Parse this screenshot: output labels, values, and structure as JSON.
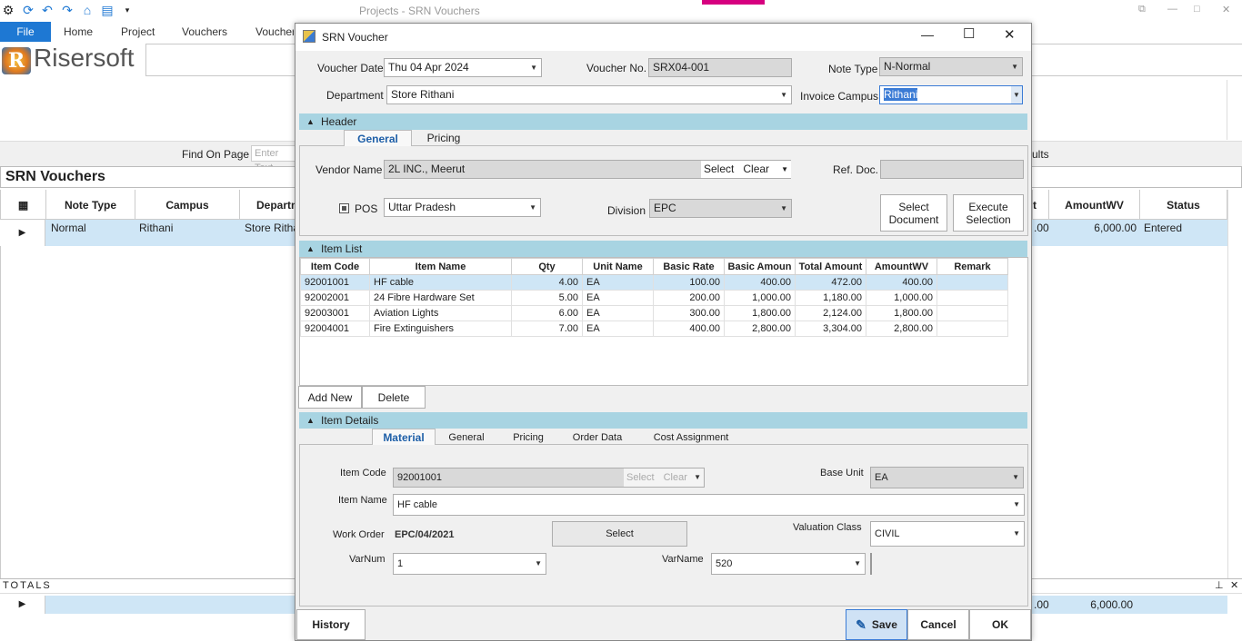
{
  "app": {
    "title": "Projects - SRN Vouchers",
    "brand": "Risersoft"
  },
  "ribbon": {
    "file": "File",
    "tabs": [
      "Home",
      "Project",
      "Vouchers",
      "Vouchers"
    ]
  },
  "find": {
    "label": "Find On Page",
    "placeholder": "Enter Text",
    "results": "ults"
  },
  "grid": {
    "title": "SRN Vouchers",
    "columns": [
      "Note Type",
      "Campus",
      "Department",
      "AmountWV",
      "Status"
    ],
    "row": {
      "note_type": "Normal",
      "campus": "Rithani",
      "department": "Store Ritha",
      "amount_partial": ".00",
      "amountwv": "6,000.00",
      "status": "Entered"
    },
    "header_partial": "t"
  },
  "totals": {
    "label": "TOTALS",
    "amount_partial": ".00",
    "amountwv": "6,000.00"
  },
  "dialog": {
    "title": "SRN Voucher",
    "voucher_date_label": "Voucher Date",
    "voucher_date": "Thu 04 Apr 2024",
    "voucher_no_label": "Voucher No.",
    "voucher_no": "SRX04-001",
    "note_type_label": "Note Type",
    "note_type": "N-Normal",
    "department_label": "Department",
    "department": "Store Rithani",
    "invoice_campus_label": "Invoice Campus",
    "invoice_campus": "Rithani",
    "header_section": "Header",
    "header_tabs": [
      "General",
      "Pricing"
    ],
    "vendor_label": "Vendor Name",
    "vendor": "2L INC., Meerut",
    "vendor_select": "Select",
    "vendor_clear": "Clear",
    "ref_doc_label": "Ref. Doc.",
    "pos_label": "POS",
    "pos_state": "Uttar Pradesh",
    "division_label": "Division",
    "division": "EPC",
    "select_document": "Select Document",
    "execute_selection": "Execute Selection",
    "item_list_section": "Item List",
    "item_columns": [
      "Item Code",
      "Item Name",
      "Qty",
      "Unit Name",
      "Basic Rate",
      "Basic Amoun",
      "Total Amount",
      "AmountWV",
      "Remark"
    ],
    "items": [
      {
        "code": "92001001",
        "name": "HF cable",
        "qty": "4.00",
        "unit": "EA",
        "rate": "100.00",
        "basic": "400.00",
        "total": "472.00",
        "wv": "400.00",
        "remark": ""
      },
      {
        "code": "92002001",
        "name": "24 Fibre Hardware Set",
        "qty": "5.00",
        "unit": "EA",
        "rate": "200.00",
        "basic": "1,000.00",
        "total": "1,180.00",
        "wv": "1,000.00",
        "remark": ""
      },
      {
        "code": "92003001",
        "name": "Aviation Lights",
        "qty": "6.00",
        "unit": "EA",
        "rate": "300.00",
        "basic": "1,800.00",
        "total": "2,124.00",
        "wv": "1,800.00",
        "remark": ""
      },
      {
        "code": "92004001",
        "name": "Fire Extinguishers",
        "qty": "7.00",
        "unit": "EA",
        "rate": "400.00",
        "basic": "2,800.00",
        "total": "3,304.00",
        "wv": "2,800.00",
        "remark": ""
      }
    ],
    "add_new": "Add New",
    "delete": "Delete",
    "item_details_section": "Item Details",
    "detail_tabs": [
      "Material",
      "General",
      "Pricing",
      "Order Data",
      "Cost Assignment"
    ],
    "item_code_label": "Item Code",
    "item_code": "92001001",
    "item_code_select": "Select",
    "item_code_clear": "Clear",
    "base_unit_label": "Base Unit",
    "base_unit": "EA",
    "item_name_label": "Item Name",
    "item_name": "HF cable",
    "work_order_label": "Work Order",
    "work_order": "EPC/04/2021",
    "select": "Select",
    "valuation_class_label": "Valuation Class",
    "valuation_class": "CIVIL",
    "varnum_label": "VarNum",
    "varnum": "1",
    "varname_label": "VarName",
    "varname": "520",
    "history": "History",
    "save": "Save",
    "cancel": "Cancel",
    "ok": "OK"
  },
  "colors": {
    "accent": "#1e78d3",
    "section": "#a8d4e2",
    "selected_row": "#cfe6f6",
    "pink": "#d6007f"
  }
}
